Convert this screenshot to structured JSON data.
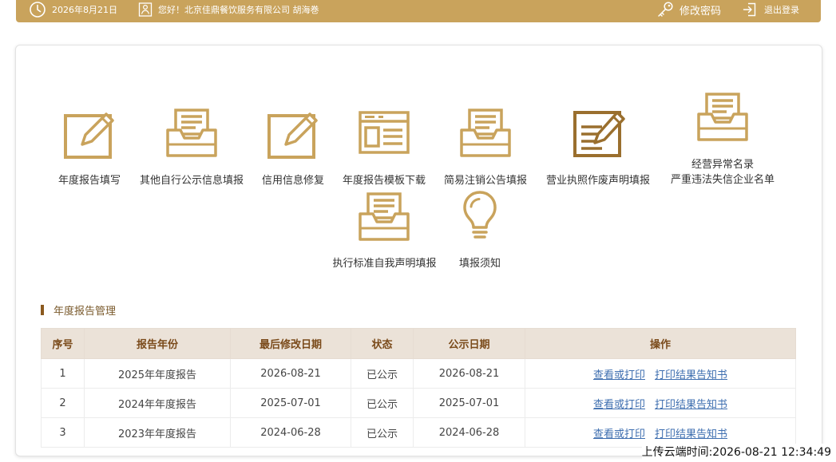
{
  "topbar": {
    "date": "2026年8月21日",
    "greeting": "您好！北京佳鼎餐饮服务有限公司  胡海巻",
    "change_password": "修改密码",
    "logout": "退出登录"
  },
  "tiles": [
    {
      "label": "年度报告填写",
      "icon": "edit-icon"
    },
    {
      "label": "其他自行公示信息填报",
      "icon": "inbox-tray-icon"
    },
    {
      "label": "信用信息修复",
      "icon": "edit-icon"
    },
    {
      "label": "年度报告模板下载",
      "icon": "template-icon"
    },
    {
      "label": "简易注销公告填报",
      "icon": "inbox-tray-icon"
    },
    {
      "label": "营业执照作废声明填报",
      "icon": "document-edit-icon"
    },
    {
      "label_line1": "经营异常名录",
      "label_line2": "严重违法失信企业名单",
      "icon": "inbox-tray-icon"
    },
    {
      "label": "执行标准自我声明填报",
      "icon": "inbox-tray-icon"
    },
    {
      "label": "填报须知",
      "icon": "lightbulb-icon"
    }
  ],
  "section": {
    "title": "年度报告管理"
  },
  "table": {
    "headers": [
      "序号",
      "报告年份",
      "最后修改日期",
      "状态",
      "公示日期",
      "操作"
    ],
    "rows": [
      {
        "no": "1",
        "year": "2025年年度报告",
        "modified": "2026-08-21",
        "status": "已公示",
        "publish": "2026-08-21",
        "action1": "查看或打印",
        "action2": "打印结果告知书"
      },
      {
        "no": "2",
        "year": "2024年年度报告",
        "modified": "2025-07-01",
        "status": "已公示",
        "publish": "2025-07-01",
        "action1": "查看或打印",
        "action2": "打印结果告知书"
      },
      {
        "no": "3",
        "year": "2023年年度报告",
        "modified": "2024-06-28",
        "status": "已公示",
        "publish": "2024-06-28",
        "action1": "查看或打印",
        "action2": "打印结果告知书"
      }
    ]
  },
  "footer": {
    "upload_time": "上传云端时间:2026-08-21 12:34:49"
  },
  "colors": {
    "gold": "#c9a35c",
    "dark_gold": "#9a6f2e",
    "link": "#3f6fb0"
  }
}
